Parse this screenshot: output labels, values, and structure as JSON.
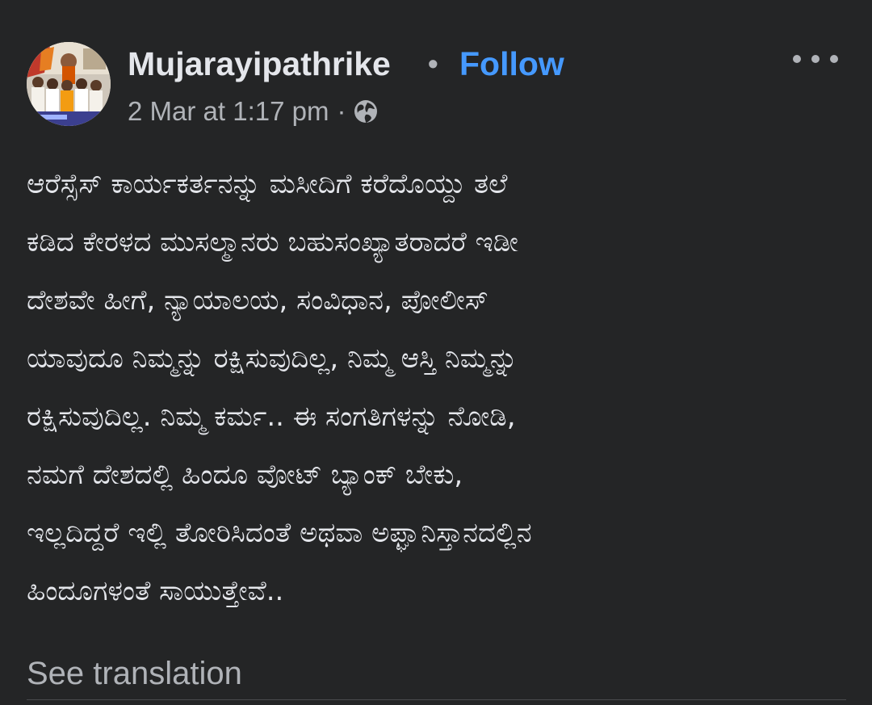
{
  "post": {
    "page_name": "Mujarayipathrike",
    "separator": "•",
    "follow_label": "Follow",
    "timestamp": "2 Mar at 1:17 pm",
    "meta_separator": "·",
    "audience_icon": "globe-icon",
    "more_icon": "more-options-icon",
    "body_lines": [
      "ಆರೆಸ್ಸೆಸ್ ಕಾರ್ಯಕರ್ತನನ್ನು ಮಸೀದಿಗೆ ಕರೆದೊಯ್ದು ತಲೆ",
      "ಕಡಿದ ಕೇರಳದ ಮುಸಲ್ಮಾನರು ಬಹುಸಂಖ್ಯಾತರಾದರೆ ಇಡೀ",
      "ದೇಶವೇ ಹೀಗೆ, ನ್ಯಾಯಾಲಯ, ಸಂವಿಧಾನ, ಪೋಲೀಸ್",
      "ಯಾವುದೂ ನಿಮ್ಮನ್ನು ರಕ್ಷಿಸುವುದಿಲ್ಲ, ನಿಮ್ಮ ಆಸ್ತಿ ನಿಮ್ಮನ್ನು",
      "ರಕ್ಷಿಸುವುದಿಲ್ಲ. ನಿಮ್ಮ ಕರ್ಮ.. ಈ ಸಂಗತಿಗಳನ್ನು ನೋಡಿ,",
      "ನಮಗೆ ದೇಶದಲ್ಲಿ ಹಿಂದೂ ವೋಟ್ ಬ್ಯಾಂಕ್ ಬೇಕು,",
      "ಇಲ್ಲದಿದ್ದರೆ ಇಲ್ಲಿ ತೋರಿಸಿದಂತೆ ಅಥವಾ ಅಫ್ಘಾನಿಸ್ತಾನದಲ್ಲಿನ",
      "ಹಿಂದೂಗಳಂತೆ ಸಾಯುತ್ತೇವೆ.."
    ],
    "see_translation_label": "See translation"
  },
  "colors": {
    "background": "#242526",
    "primary_text": "#e4e6eb",
    "secondary_text": "#b0b3b8",
    "link": "#4599ff"
  }
}
